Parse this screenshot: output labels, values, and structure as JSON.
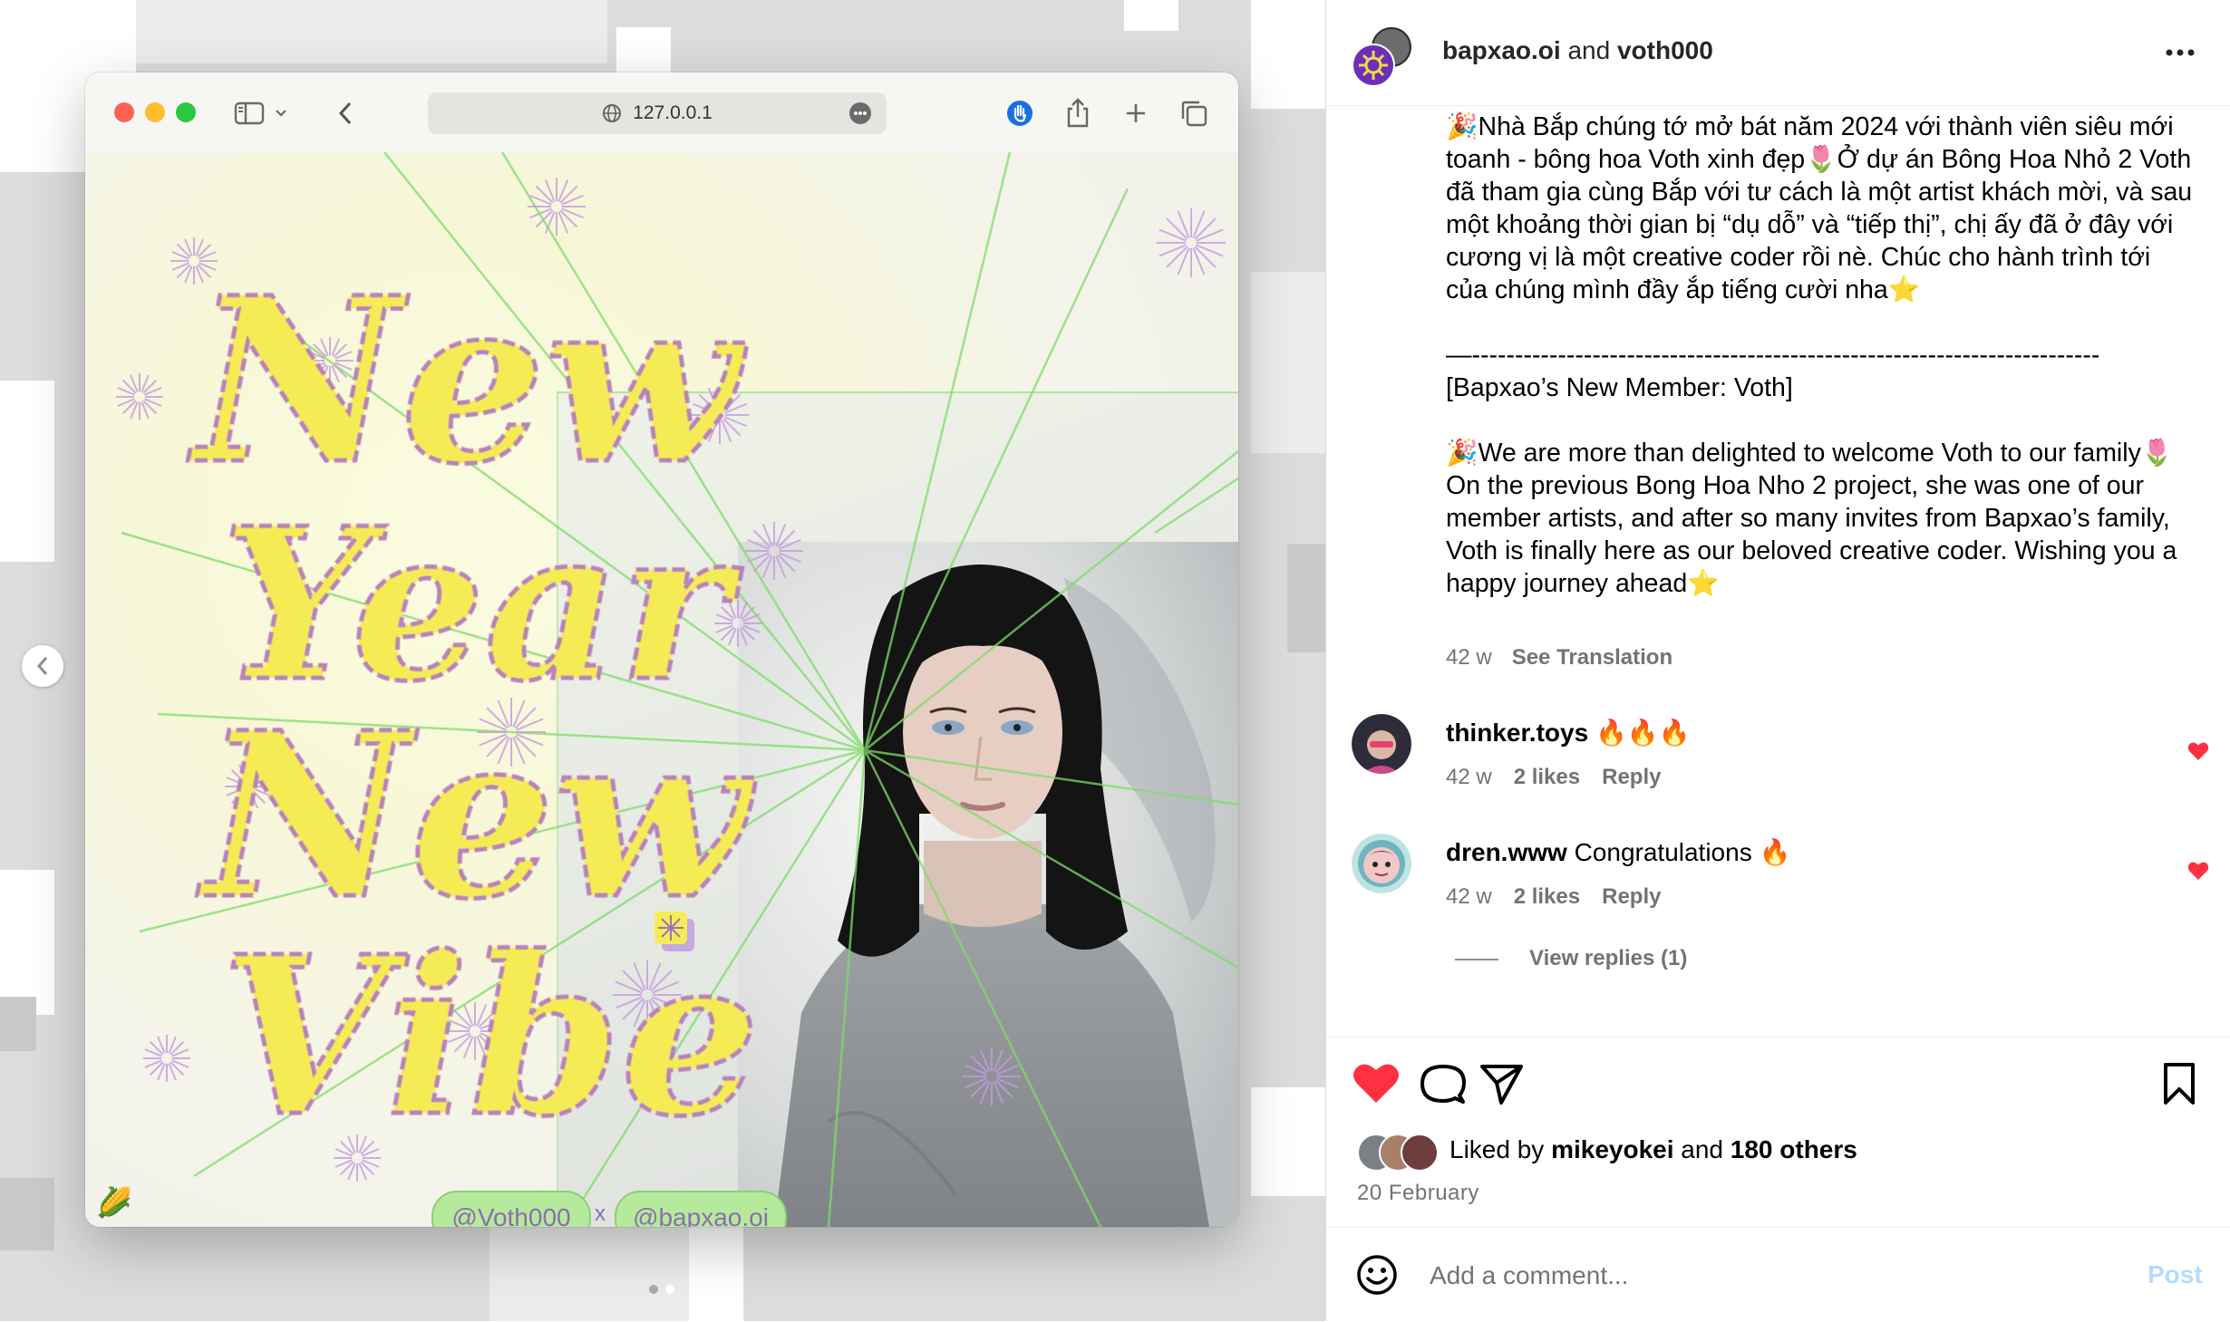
{
  "browser": {
    "url": "127.0.0.1"
  },
  "artwork": {
    "headline_lines": [
      "New",
      "Year",
      "New",
      "Vibe"
    ],
    "tag_left": "@Voth000",
    "tag_sep": "x",
    "tag_right": "@bapxao.oi",
    "corner_emoji": "🌽"
  },
  "post": {
    "author": "bapxao.oi",
    "joiner": " and ",
    "coauthor": "voth000",
    "caption_vi": "🎉Nhà Bắp chúng tớ mở bát năm 2024 với thành viên siêu mới toanh - bông hoa Voth xinh đẹp🌷Ở dự án Bông Hoa Nhỏ 2 Voth đã tham gia cùng Bắp với tư cách là một artist khách mời, và sau một khoảng thời gian bị “dụ dỗ” và “tiếp thị”, chị ấy đã ở đây với cương vị là một creative coder rồi nè. Chúc cho hành trình tới của chúng mình đầy ắp tiếng cười nha⭐",
    "divider": "—-------------------------------------------------------------------------",
    "caption_en_title": "[Bapxao’s New Member: Voth]",
    "caption_en": "🎉We are more than delighted to welcome Voth to our family🌷 On the previous Bong Hoa Nho 2 project, she was one of our member artists, and after so many invites from Bapxao’s family, Voth is finally here as our beloved creative coder. Wishing you a happy journey ahead⭐",
    "age": "42 w",
    "see_translation": "See Translation",
    "liked_prefix": "Liked by ",
    "liked_user": "mikeyokei",
    "liked_and": " and ",
    "liked_others": "180 others",
    "date": "20 February"
  },
  "comments": [
    {
      "user": "thinker.toys",
      "text": "🔥🔥🔥",
      "age": "42 w",
      "likes": "2 likes",
      "reply": "Reply"
    },
    {
      "user": "dren.www",
      "text": "Congratulations 🔥",
      "age": "42 w",
      "likes": "2 likes",
      "reply": "Reply"
    }
  ],
  "view_replies": "View replies (1)",
  "composer": {
    "placeholder": "Add a comment...",
    "post_label": "Post"
  },
  "colors": {
    "like_red": "#ff3040",
    "meta_gray": "#737373",
    "post_blue_disabled": "#b3dbff",
    "tag_green": "#b5ea9c",
    "headline_yellow": "#f5ec55"
  },
  "icons": {
    "more": "more-horizontal-icon",
    "like": "heart-filled-icon",
    "comment": "comment-bubble-icon",
    "share": "paper-plane-icon",
    "save": "bookmark-icon",
    "emoji": "emoji-smile-icon",
    "prev": "chevron-left-icon"
  }
}
